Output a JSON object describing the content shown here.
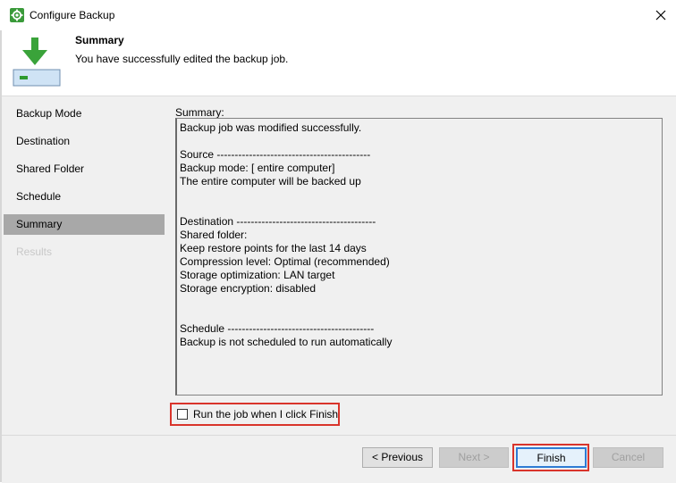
{
  "window": {
    "title": "Configure Backup"
  },
  "header": {
    "title": "Summary",
    "subtitle": "You have successfully edited the backup job."
  },
  "nav": {
    "items": [
      {
        "label": "Backup Mode",
        "state": "normal"
      },
      {
        "label": "Destination",
        "state": "normal"
      },
      {
        "label": "Shared Folder",
        "state": "normal"
      },
      {
        "label": "Schedule",
        "state": "normal"
      },
      {
        "label": "Summary",
        "state": "active"
      },
      {
        "label": "Results",
        "state": "disabled"
      }
    ]
  },
  "summary": {
    "label": "Summary:",
    "lines": [
      "Backup job was modified successfully.",
      "",
      "Source -------------------------------------------",
      "Backup mode: [ entire computer]",
      "The entire computer will be backed up",
      "",
      "",
      "Destination ---------------------------------------",
      "Shared folder:",
      "Keep restore points for the last 14 days",
      "Compression level: Optimal (recommended)",
      "Storage optimization: LAN target",
      "Storage encryption: disabled",
      "",
      "",
      "Schedule -----------------------------------------",
      "Backup is not scheduled to run automatically"
    ]
  },
  "run_checkbox": {
    "label": "Run the job when I click Finish",
    "checked": false
  },
  "buttons": {
    "previous": "< Previous",
    "next": "Next >",
    "finish": "Finish",
    "cancel": "Cancel"
  },
  "colors": {
    "accent_green": "#3a9a3a",
    "highlight_red": "#d9342b",
    "focus_blue": "#2d7bd4",
    "nav_active": "#a8a8a8"
  },
  "icons": {
    "app": "gear-icon",
    "header": "download-arrow-icon",
    "close": "close-icon"
  }
}
